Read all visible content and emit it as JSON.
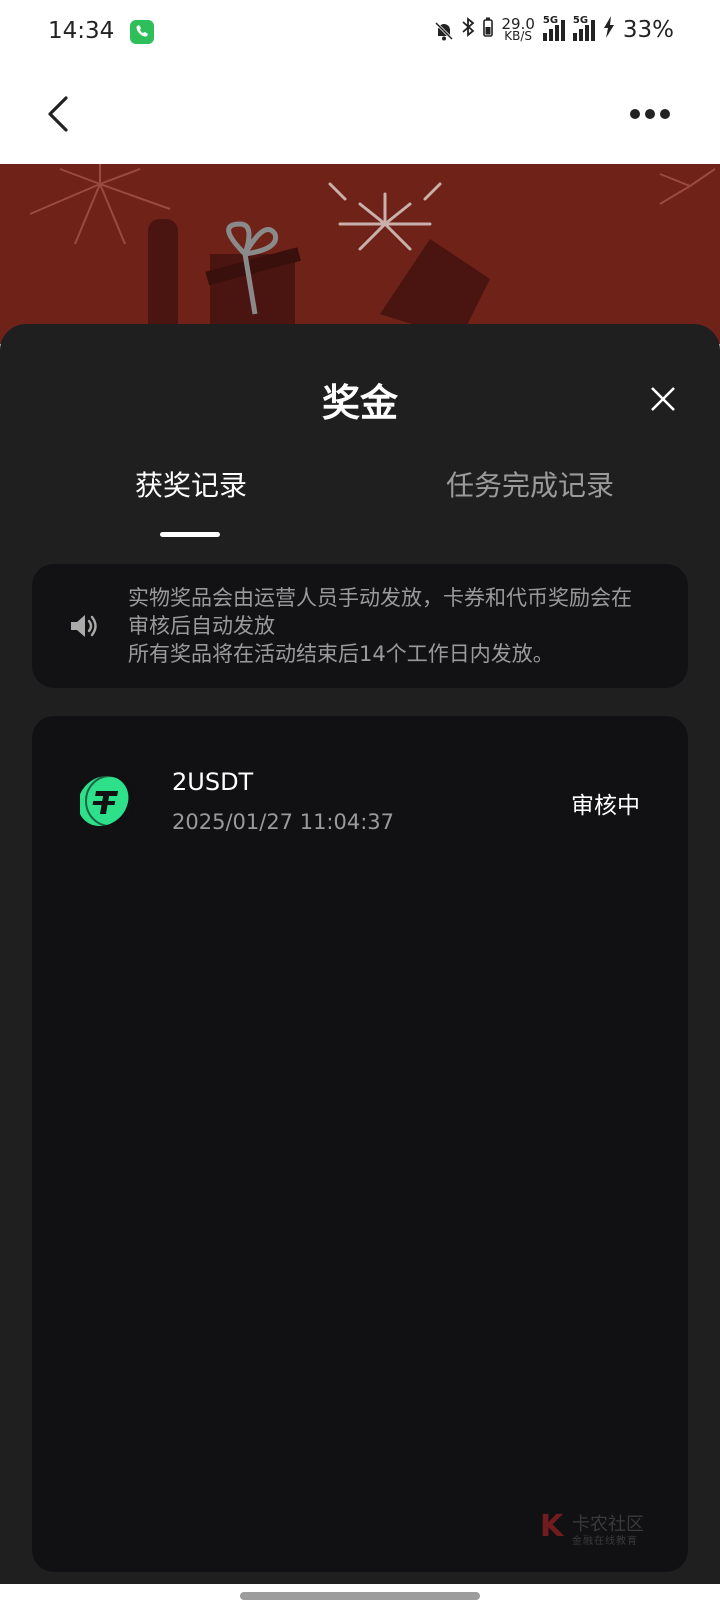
{
  "status_bar": {
    "time": "14:34",
    "net_speed_value": "29.0",
    "net_speed_unit": "KB/S",
    "signal_1_label": "5G",
    "signal_2_label": "5G",
    "battery": "33%",
    "icons": [
      "phone-call-icon",
      "bell-off-icon",
      "bluetooth-icon",
      "signal-icon",
      "charging-icon"
    ]
  },
  "nav": {
    "icons": [
      "back-icon",
      "more-icon"
    ]
  },
  "sheet": {
    "title": "奖金",
    "tabs": [
      {
        "label": "获奖记录",
        "active": true
      },
      {
        "label": "任务完成记录",
        "active": false
      }
    ],
    "notice_line_1": "实物奖品会由运营人员手动发放，卡券和代币奖励会在审核后自动发放",
    "notice_line_2": "所有奖品将在活动结束后14个工作日内发放。",
    "records": [
      {
        "name": "2USDT",
        "time": "2025/01/27 11:04:37",
        "status": "审核中",
        "icon": "usdt-coin-icon"
      }
    ]
  },
  "watermark": {
    "text": "卡农社区",
    "sub": "金融在线教育"
  },
  "colors": {
    "banner": "#6e2218",
    "sheet_bg": "#1f1f20",
    "card_bg": "#111113",
    "accent_green": "#2ee08a"
  }
}
